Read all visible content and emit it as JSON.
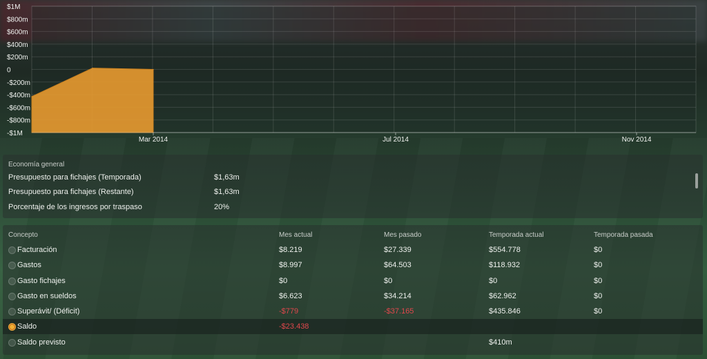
{
  "chart_data": {
    "type": "area",
    "y_ticks": [
      "$1M",
      "$800m",
      "$600m",
      "$400m",
      "$200m",
      "0",
      "-$200m",
      "-$400m",
      "-$600m",
      "-$800m",
      "-$1M"
    ],
    "ylim": [
      -1000000,
      1000000
    ],
    "x_ticks": [
      "Mar 2014",
      "Jul 2014",
      "Nov 2014"
    ],
    "series": [
      {
        "x": [
          "Feb 2014 (start)",
          "Feb 2014 (mid)",
          "Mar 2014"
        ],
        "values": [
          -430000,
          20000,
          0
        ]
      }
    ],
    "fill_color": "#e89a30",
    "grid": true
  },
  "economy": {
    "title": "Economía general",
    "rows": [
      {
        "label": "Presupuesto para fichajes (Temporada)",
        "value": "$1,63m"
      },
      {
        "label": "Presupuesto para fichajes (Restante)",
        "value": "$1,63m"
      },
      {
        "label": "Porcentaje de los ingresos por traspaso",
        "value": "20%"
      }
    ]
  },
  "finance": {
    "headers": {
      "concept": "Concepto",
      "current_month": "Mes actual",
      "last_month": "Mes pasado",
      "current_season": "Temporada actual",
      "last_season": "Temporada pasada"
    },
    "rows": [
      {
        "label": "Facturación",
        "current_month": "$8.219",
        "last_month": "$27.339",
        "current_season": "$554.778",
        "last_season": "$0"
      },
      {
        "label": "Gastos",
        "current_month": "$8.997",
        "last_month": "$64.503",
        "current_season": "$118.932",
        "last_season": "$0"
      },
      {
        "label": "Gasto fichajes",
        "current_month": "$0",
        "last_month": "$0",
        "current_season": "$0",
        "last_season": "$0"
      },
      {
        "label": "Gasto en sueldos",
        "current_month": "$6.623",
        "last_month": "$34.214",
        "current_season": "$62.962",
        "last_season": "$0"
      },
      {
        "label": "Superávit/ (Déficit)",
        "current_month": "-$779",
        "last_month": "-$37.165",
        "current_season": "$435.846",
        "last_season": "$0"
      },
      {
        "label": "Saldo",
        "current_month": "-$23.438",
        "last_month": "",
        "current_season": "",
        "last_season": ""
      },
      {
        "label": "Saldo previsto",
        "current_month": "",
        "last_month": "",
        "current_season": "$410m",
        "last_season": ""
      }
    ]
  },
  "colors": {
    "negative": "#e0474c",
    "accent": "#e89a30"
  }
}
